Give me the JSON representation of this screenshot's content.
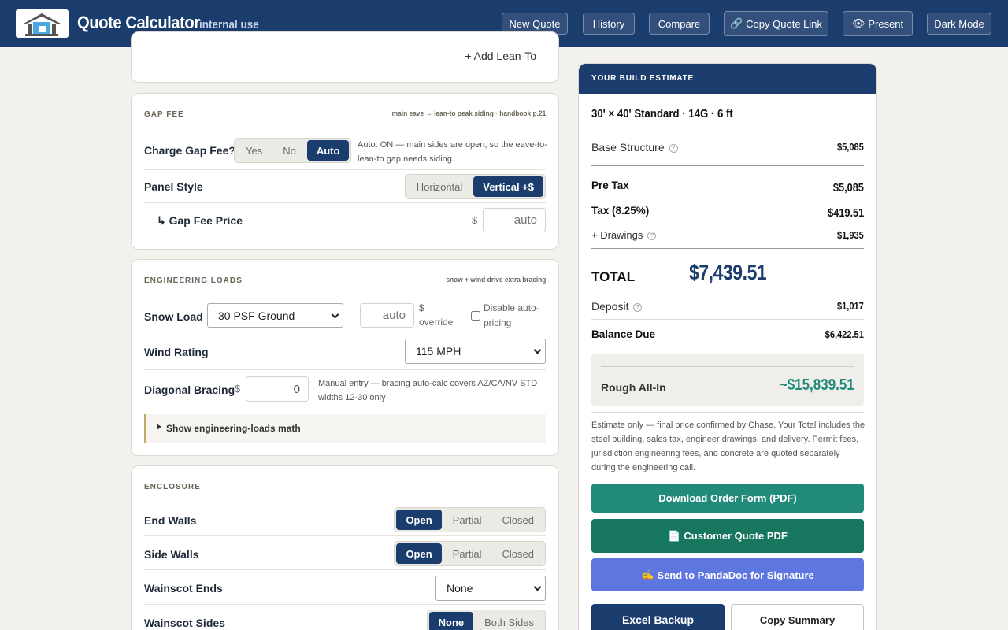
{
  "header": {
    "title": "Quote Calculator",
    "subtitle": "internal use",
    "buttons": {
      "new_quote": "New Quote",
      "history": "History",
      "compare": "Compare",
      "copy_link": "Copy Quote Link",
      "present": "Present",
      "dark_mode": "Dark Mode"
    }
  },
  "lean_to": {
    "add_label": "+ Add Lean-To"
  },
  "gap_fee": {
    "heading": "GAP FEE",
    "note": "main eave → lean-to peak siding · handbook p.21",
    "charge_label": "Charge Gap Fee?",
    "charge_options": [
      "Yes",
      "No",
      "Auto"
    ],
    "charge_selected": "Auto",
    "charge_help": "Auto: ON — main sides are open, so the eave-to-lean-to gap needs siding.",
    "panel_label": "Panel Style",
    "panel_options": [
      "Horizontal",
      "Vertical +$"
    ],
    "panel_selected": "Vertical +$",
    "price_label": "↳ Gap Fee Price",
    "price_currency": "$",
    "price_placeholder": "auto"
  },
  "engineering": {
    "heading": "ENGINEERING LOADS",
    "note": "snow + wind drive extra bracing",
    "snow_label": "Snow Load",
    "snow_value": "30 PSF Ground",
    "snow_override_placeholder": "auto",
    "override_label_1": "$",
    "override_label_2": "override",
    "disable_label_1": "Disable auto-",
    "disable_label_2": "pricing",
    "wind_label": "Wind Rating",
    "wind_value": "115 MPH",
    "bracing_label": "Diagonal Bracing",
    "bracing_currency": "$",
    "bracing_value": "0",
    "bracing_help": "Manual entry — bracing auto-calc covers AZ/CA/NV STD widths 12-30 only",
    "math_toggle": "Show engineering-loads math"
  },
  "enclosure": {
    "heading": "ENCLOSURE",
    "end_walls_label": "End Walls",
    "end_walls_options": [
      "Open",
      "Partial",
      "Closed"
    ],
    "end_walls_selected": "Open",
    "side_walls_label": "Side Walls",
    "side_walls_options": [
      "Open",
      "Partial",
      "Closed"
    ],
    "side_walls_selected": "Open",
    "wainscot_ends_label": "Wainscot Ends",
    "wainscot_ends_value": "None",
    "wainscot_sides_label": "Wainscot Sides",
    "wainscot_sides_options": [
      "None",
      "Both Sides"
    ],
    "wainscot_sides_selected": "None"
  },
  "estimate": {
    "heading": "YOUR BUILD ESTIMATE",
    "summary": "30' × 40' Standard · 14G · 6 ft",
    "base_label": "Base Structure",
    "base_value": "$5,085",
    "pretax_label": "Pre Tax",
    "pretax_value": "$5,085",
    "tax_label": "Tax (8.25%)",
    "tax_value": "$419.51",
    "drawings_label": "+ Drawings",
    "drawings_value": "$1,935",
    "total_label": "TOTAL",
    "total_value": "$7,439.51",
    "deposit_label": "Deposit",
    "deposit_value": "$1,017",
    "balance_label": "Balance Due",
    "balance_value": "$6,422.51",
    "rough_label": "Rough All-In",
    "rough_value": "~$15,839.51",
    "disclaimer": "Estimate only — final price confirmed by Chase. Your Total includes the steel building, sales tax, engineer drawings, and delivery. Permit fees, jurisdiction engineering fees, and concrete are quoted separately during the engineering call.",
    "btn_order": "Download Order Form (PDF)",
    "btn_customer": "Customer Quote PDF",
    "btn_pandadoc": "Send to PandaDoc for Signature",
    "btn_excel": "Excel Backup",
    "btn_copy": "Copy Summary"
  },
  "colors": {
    "navy": "#1b3d6d",
    "teal": "#218a7a",
    "green": "#17775e",
    "indigo": "#5e77e0",
    "rough_text": "#218a7a"
  }
}
